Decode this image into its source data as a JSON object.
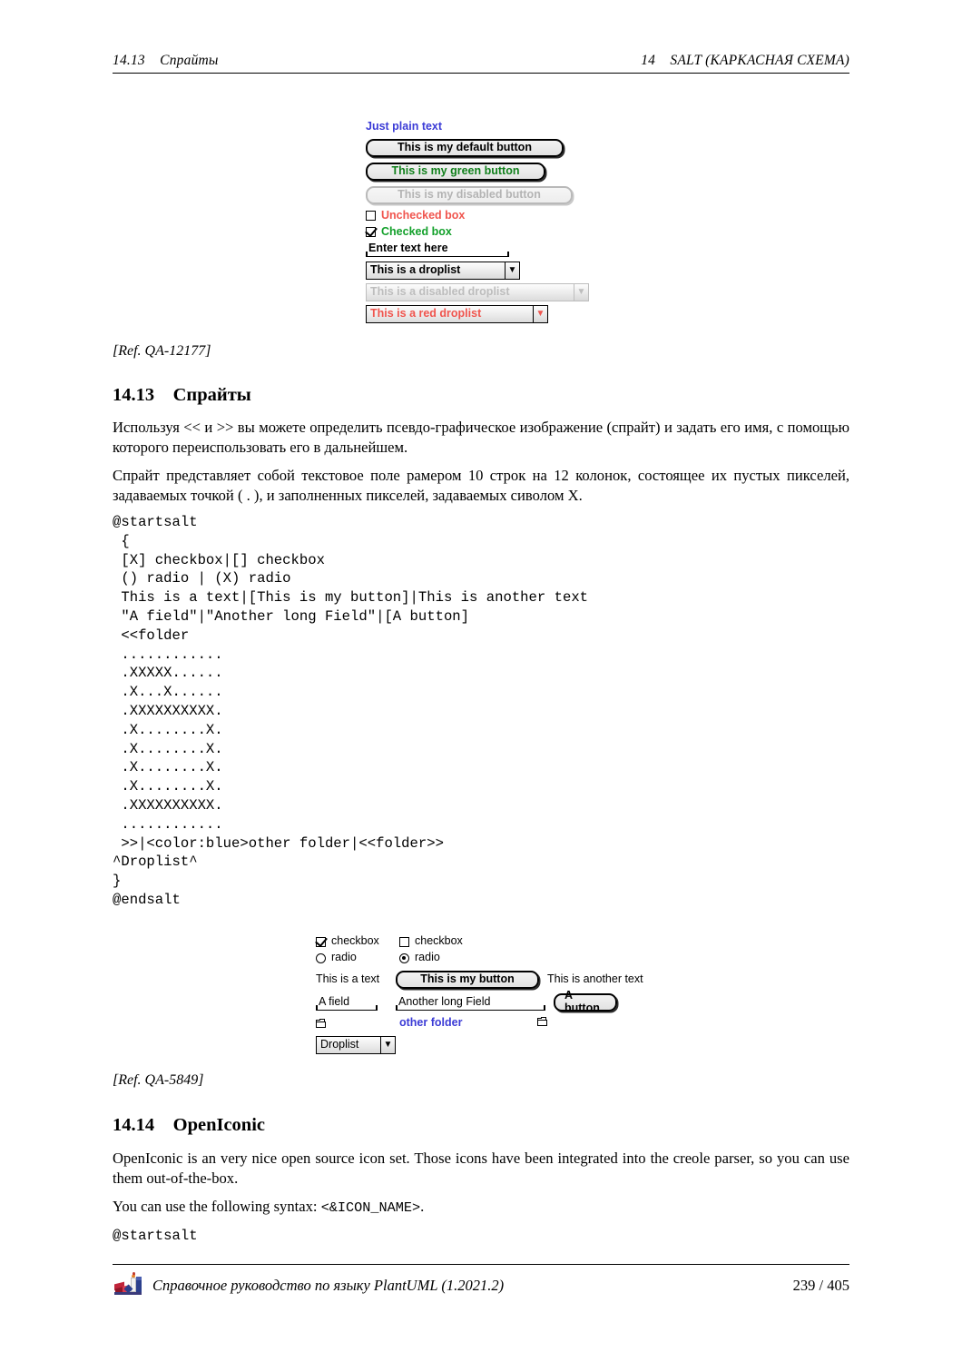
{
  "header": {
    "left": "14.13    Спрайты",
    "right": "14    SALT (КАРКАСНАЯ СХЕМА)"
  },
  "figure_top": {
    "name": "salt-widgets-preview",
    "plain_text": "Just plain text",
    "buttons": [
      {
        "label": "This is my default button",
        "state": "default"
      },
      {
        "label": "This is my green button",
        "state": "green"
      },
      {
        "label": "This is my disabled button",
        "state": "disabled"
      }
    ],
    "checkboxes": [
      {
        "label": "Unchecked box",
        "checked": false,
        "color": "#f0554e"
      },
      {
        "label": "Checked box",
        "checked": true,
        "color": "#12a02a"
      }
    ],
    "field": {
      "value": "Enter text here"
    },
    "droplists": [
      {
        "label": "This is a droplist",
        "state": "default"
      },
      {
        "label": "This is a disabled droplist",
        "state": "disabled"
      },
      {
        "label": "This is a red droplist",
        "state": "red"
      }
    ],
    "arrow_glyph": "▼"
  },
  "ref_1": "[Ref. QA-12177]",
  "section_13": {
    "number": "14.13",
    "title": "Спрайты",
    "heading": "14.13    Спрайты",
    "p1": "Используя << и >> вы можете определить псевдо-графическое изображение (спрайт) и задать его имя, с помощью которого переиспользовать его в дальнейшем.",
    "p2": "Спрайт представляет собой текстовое поле рамером 10 строк на 12 колонок, состоящее их пустых пикселей, задаваемых точкой ( . ), и заполненных пикселей, задаваемых сиволом X."
  },
  "code_block": "@startsalt\n {\n [X] checkbox|[] checkbox\n () radio | (X) radio\n This is a text|[This is my button]|This is another text\n \"A field\"|\"Another long Field\"|[A button]\n <<folder\n ............\n .XXXXX......\n .X...X......\n .XXXXXXXXXX.\n .X........X.\n .X........X.\n .X........X.\n .X........X.\n .XXXXXXXXXX.\n ............\n >>|<color:blue>other folder|<<folder>>\n^Droplist^\n}\n@endsalt",
  "figure_bottom": {
    "name": "salt-sprite-preview",
    "row_checkbox": [
      {
        "label": "checkbox",
        "checked": true
      },
      {
        "label": "checkbox",
        "checked": false
      }
    ],
    "row_radio": [
      {
        "label": "radio",
        "selected": false
      },
      {
        "label": "radio",
        "selected": true
      }
    ],
    "row_text": {
      "left": "This is a text",
      "button": "This is my button",
      "right": "This is another text"
    },
    "row_fields": {
      "field1": "A field",
      "field2": "Another long Field",
      "button": "A button"
    },
    "row_sprites": {
      "middle_label": "other folder",
      "middle_color": "#3b3bd6"
    },
    "droplist": {
      "label": "Droplist",
      "arrow_glyph": "▼"
    }
  },
  "ref_2": "[Ref. QA-5849]",
  "section_14": {
    "number": "14.14",
    "title": "OpenIconic",
    "heading": "14.14    OpenIconic",
    "p1": "OpenIconic is an very nice open source icon set.  Those icons have been integrated into the creole parser, so you can use them out-of-the-box.",
    "p2_prefix": "You can use the following syntax: ",
    "p2_code": "<&ICON_NAME>",
    "p2_suffix": ".",
    "code": "@startsalt"
  },
  "footer": {
    "title": "Справочное руководство по языку PlantUML (1.2021.2)",
    "page": "239 / 405"
  }
}
